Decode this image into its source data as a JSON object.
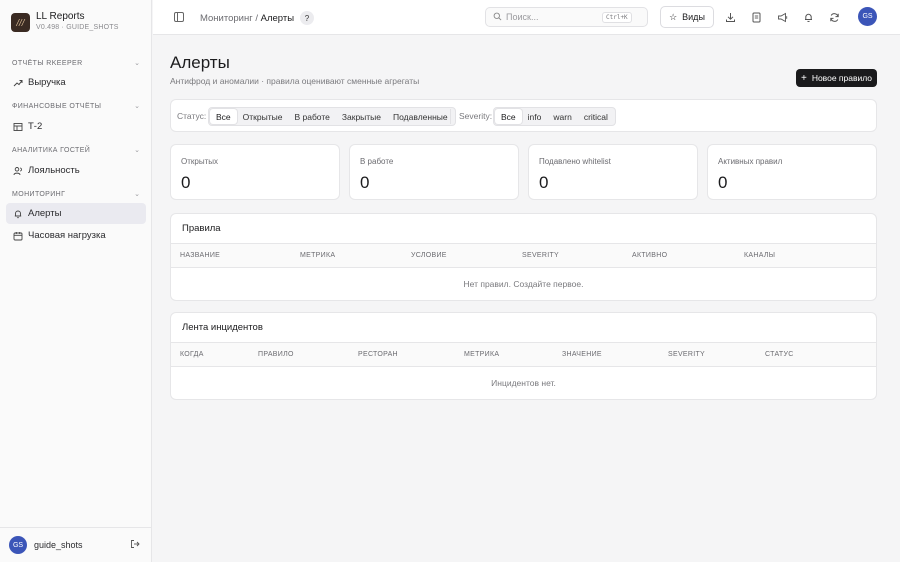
{
  "brand": {
    "logo_text": "///",
    "name": "LL Reports",
    "version": "V0.498 · GUIDE_SHOTS"
  },
  "sidebar": {
    "sections": [
      {
        "label": "ОТЧЁТЫ RKEEPER",
        "items": [
          {
            "label": "Выручка",
            "icon": "trend-up-icon"
          }
        ]
      },
      {
        "label": "ФИНАНСОВЫЕ ОТЧЁТЫ",
        "items": [
          {
            "label": "Т-2",
            "icon": "table-icon"
          }
        ]
      },
      {
        "label": "АНАЛИТИКА ГОСТЕЙ",
        "items": [
          {
            "label": "Лояльность",
            "icon": "users-icon"
          }
        ]
      },
      {
        "label": "МОНИТОРИНГ",
        "items": [
          {
            "label": "Алерты",
            "icon": "bell-icon",
            "active": true
          },
          {
            "label": "Часовая нагрузка",
            "icon": "calendar-icon"
          }
        ]
      }
    ],
    "user": {
      "initials": "GS",
      "name": "guide_shots"
    }
  },
  "topbar": {
    "breadcrumb": {
      "parent": "Мониторинг",
      "separator": " / ",
      "current": "Алерты"
    },
    "help_label": "?",
    "search": {
      "placeholder": "Поиск...",
      "shortcut": "Ctrl+K"
    },
    "views_label": "Виды",
    "avatar_initials": "GS"
  },
  "page": {
    "title": "Алерты",
    "subtitle": "Антифрод и аномалии · правила оценивают сменные агрегаты",
    "new_rule_label": "Новое правило"
  },
  "filters": {
    "status_label": "Статус:",
    "status_options": [
      "Все",
      "Открытые",
      "В работе",
      "Закрытые",
      "Подавленные"
    ],
    "status_selected": "Все",
    "severity_label": "Severity:",
    "severity_options": [
      "Все",
      "info",
      "warn",
      "critical"
    ],
    "severity_selected": "Все"
  },
  "stats": [
    {
      "label": "Открытых",
      "value": "0"
    },
    {
      "label": "В работе",
      "value": "0"
    },
    {
      "label": "Подавлено whitelist",
      "value": "0"
    },
    {
      "label": "Активных правил",
      "value": "0"
    }
  ],
  "rules": {
    "title": "Правила",
    "columns": [
      "НАЗВАНИЕ",
      "МЕТРИКА",
      "УСЛОВИЕ",
      "SEVERITY",
      "АКТИВНО",
      "КАНАЛЫ"
    ],
    "empty_text": "Нет правил. Создайте первое."
  },
  "incidents": {
    "title": "Лента инцидентов",
    "columns": [
      "КОГДА",
      "ПРАВИЛО",
      "РЕСТОРАН",
      "МЕТРИКА",
      "ЗНАЧЕНИЕ",
      "SEVERITY",
      "СТАТУС"
    ],
    "empty_text": "Инцидентов нет."
  },
  "colors": {
    "accent": "#3b55b8",
    "primary_button": "#1a1a1c",
    "active_nav": "#eaeaf0"
  }
}
